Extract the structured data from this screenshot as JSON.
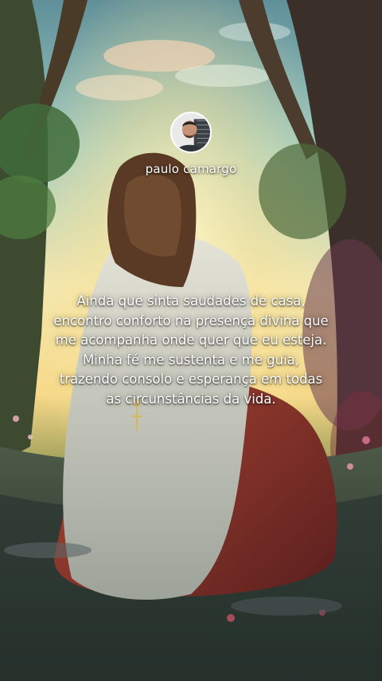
{
  "profile": {
    "username": "paulo camargo",
    "avatar_icon": "user-avatar-icon"
  },
  "quote": {
    "text": "Ainda que sinta saudades de casa, encontro conforto na presença divina que me acompanha onde quer que eu esteja. Minha fé me sustenta e me guia, trazendo consolo e esperança em todas as circunstâncias da vida."
  },
  "theme": {
    "text_color": "#ffffff",
    "sky_color": "#8fc6c4",
    "glow_color": "#fff1b0",
    "robe_color": "#d7d9d2",
    "cloak_color": "#9a3a2e"
  }
}
